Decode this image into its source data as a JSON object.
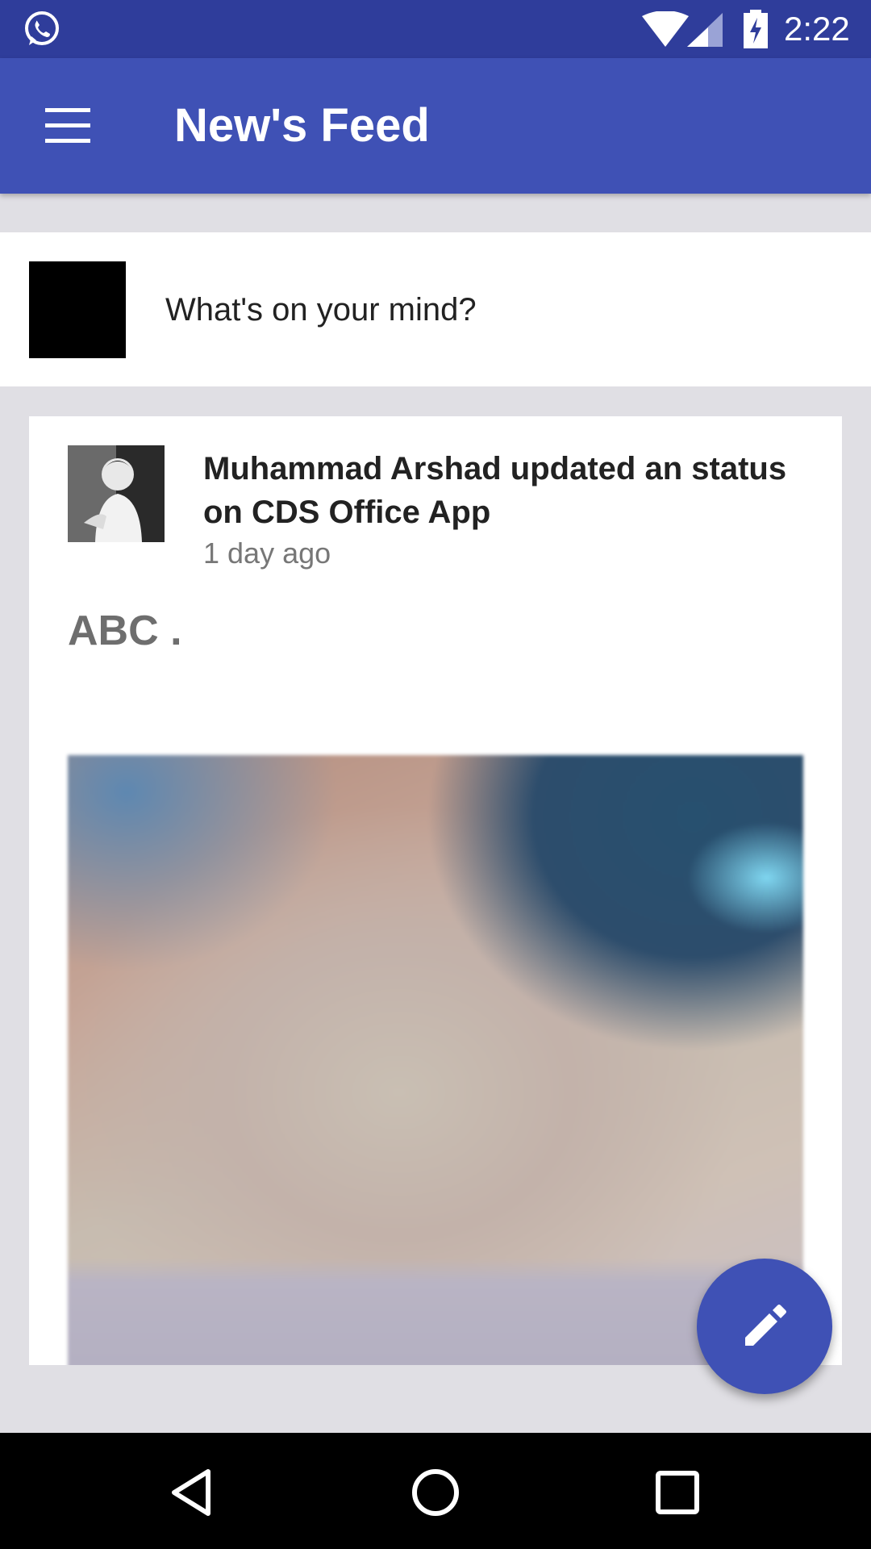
{
  "status_bar": {
    "time": "2:22",
    "icons": [
      "whatsapp-icon",
      "wifi-icon",
      "cell-signal-icon",
      "battery-charging-icon"
    ]
  },
  "app_bar": {
    "title": "New's Feed",
    "menu_icon": "hamburger-menu-icon"
  },
  "composer": {
    "prompt": "What's on your mind?"
  },
  "post": {
    "headline": "Muhammad Arshad updated an status on CDS Office App",
    "time": "1 day ago",
    "text": "ABC ."
  },
  "fab": {
    "icon": "edit-pencil-icon"
  },
  "nav_bar": {
    "icons": [
      "back-icon",
      "home-icon",
      "recent-apps-icon"
    ]
  },
  "colors": {
    "status_bar": "#2f3d9b",
    "primary": "#3f51b5",
    "background": "#e0dfe4"
  }
}
